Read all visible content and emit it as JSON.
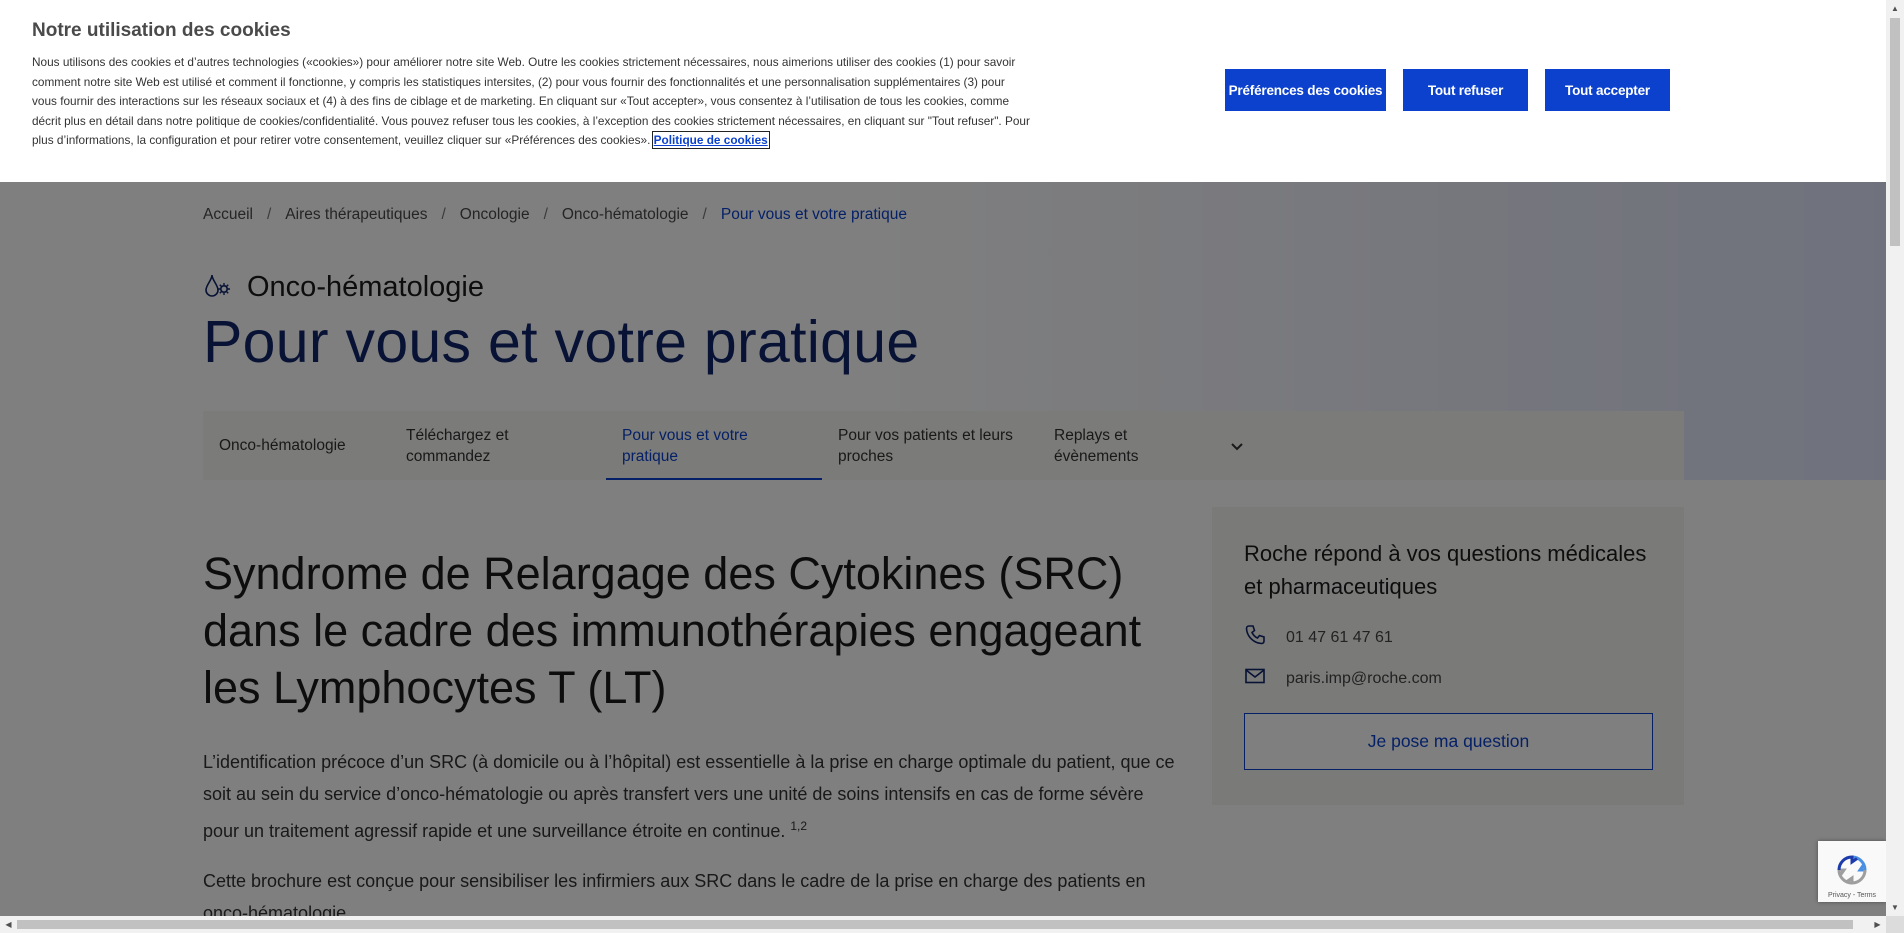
{
  "cookie_banner": {
    "title": "Notre utilisation des cookies",
    "body": "Nous utilisons des cookies et d’autres technologies («cookies») pour améliorer notre site Web. Outre les cookies strictement nécessaires, nous aimerions utiliser des cookies (1) pour savoir comment notre site Web est utilisé et comment il fonctionne, y compris les statistiques intersites, (2) pour vous fournir des fonctionnalités et une personnalisation supplémentaires (3) pour vous fournir des interactions sur les réseaux sociaux et (4) à des fins de ciblage et de marketing. En cliquant sur «Tout accepter», vous consentez à l’utilisation de tous les cookies, comme décrit plus en détail dans notre politique de cookies/confidentialité. Vous pouvez refuser tous les cookies, à l’exception des cookies strictement nécessaires, en cliquant sur \"Tout refuser\". Pour plus d’informations, la configuration et pour retirer votre consentement, veuillez cliquer sur «Préférences des cookies».",
    "policy_link": "Politique de cookies",
    "buttons": {
      "preferences": "Préférences des cookies",
      "reject_all": "Tout refuser",
      "accept_all": "Tout accepter"
    }
  },
  "breadcrumb": {
    "items": [
      "Accueil",
      "Aires thérapeutiques",
      "Oncologie",
      "Onco-hématologie",
      "Pour vous et votre pratique"
    ],
    "separator": "/"
  },
  "header": {
    "area": "Onco-hématologie",
    "title": "Pour vous et votre pratique"
  },
  "tabs": [
    {
      "label": "Onco-hématologie"
    },
    {
      "label": "Téléchargez et commandez"
    },
    {
      "label": "Pour vous et votre pratique"
    },
    {
      "label": "Pour vos patients et leurs proches"
    },
    {
      "label": "Replays et évènements"
    }
  ],
  "article": {
    "title": "Syndrome de Relargage des Cytokines (SRC) dans le cadre des immunothérapies engageant les Lymphocytes T (LT)",
    "p1": "L’identification précoce d’un SRC (à domicile ou à l’hôpital) est essentielle à la prise en charge optimale du patient, que ce soit au sein du service d’onco-hématologie ou après transfert vers une unité de soins intensifs en cas de forme sévère pour un traitement agressif rapide et une surveillance étroite en continue.",
    "p1_ref": "1,2",
    "p2": "Cette brochure est conçue pour sensibiliser les infirmiers aux SRC dans le cadre de la prise en charge des patients en onco-hématologie."
  },
  "contact": {
    "title": "Roche répond à vos questions médicales et pharmaceutiques",
    "phone": "01 47 61 47 61",
    "email": "paris.imp@roche.com",
    "button": "Je pose ma question"
  },
  "recaptcha": {
    "terms": "Privacy - Terms"
  },
  "colors": {
    "brand_blue": "#0b41cd",
    "title_navy": "#10256b",
    "overlay": "rgba(0,0,0,0.5)"
  },
  "icons": [
    "onco-hematology-icon",
    "phone-icon",
    "mail-icon",
    "chevron-down-icon",
    "recaptcha-icon"
  ]
}
